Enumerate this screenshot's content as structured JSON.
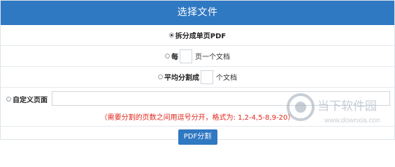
{
  "header": {
    "title": "选择文件"
  },
  "options": {
    "split_single": "拆分成单页PDF",
    "every": {
      "label": "每",
      "suffix": "页一个文档",
      "value": ""
    },
    "average": {
      "label": "平均分割成",
      "suffix": "个文档",
      "value": ""
    },
    "custom": {
      "label": "自定义页面",
      "value": ""
    }
  },
  "hint": "（需要分割的页数之间用逗号分开，格式为: 1,2-4,5-8,9-20）",
  "button": {
    "label": "PDF分割"
  },
  "watermark": {
    "text": "当下软件园",
    "url": "www.downxia.com"
  },
  "colors": {
    "header": "#2f78c2",
    "hint": "#e0261b"
  }
}
